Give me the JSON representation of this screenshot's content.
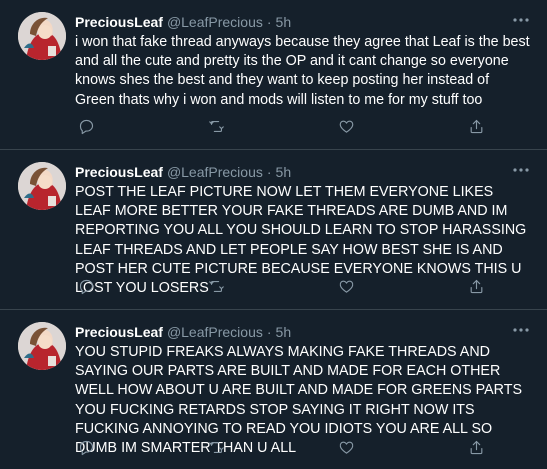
{
  "theme": {
    "background": "#15202b",
    "divider": "#38444d",
    "secondary_text": "#8899a6",
    "primary_text": "#ffffff"
  },
  "tweets": [
    {
      "display_name": "PreciousLeaf",
      "handle": "@LeafPrecious",
      "separator": "·",
      "time": "5h",
      "text": "i won that fake thread anyways because they agree that Leaf is the best and all the cute and pretty its the OP and it cant change so everyone knows shes the best and they want to keep posting her instead of Green thats why i won and mods will listen to me for my stuff too"
    },
    {
      "display_name": "PreciousLeaf",
      "handle": "@LeafPrecious",
      "separator": "·",
      "time": "5h",
      "text": "POST THE LEAF PICTURE NOW LET THEM EVERYONE LIKES LEAF MORE BETTER YOUR FAKE THREADS ARE DUMB AND IM REPORTING YOU ALL YOU SHOULD LEARN TO STOP HARASSING LEAF THREADS AND LET PEOPLE SAY HOW BEST SHE IS AND POST HER CUTE PICTURE BECAUSE EVERYONE KNOWS THIS U LOST YOU LOSERS"
    },
    {
      "display_name": "PreciousLeaf",
      "handle": "@LeafPrecious",
      "separator": "·",
      "time": "5h",
      "text": "YOU STUPID FREAKS ALWAYS MAKING FAKE THREADS AND SAYING OUR PARTS ARE BUILT AND MADE FOR EACH OTHER WELL HOW ABOUT U ARE BUILT AND MADE FOR GREENS PARTS YOU FUCKING RETARDS STOP SAYING IT RIGHT NOW ITS FUCKING ANNOYING TO READ YOU IDIOTS YOU ARE ALL SO DUMB IM SMARTER THAN U ALL"
    }
  ],
  "icons": {
    "more": "more-horizontal-icon",
    "reply": "reply-icon",
    "retweet": "retweet-icon",
    "like": "like-icon",
    "share": "share-icon"
  }
}
